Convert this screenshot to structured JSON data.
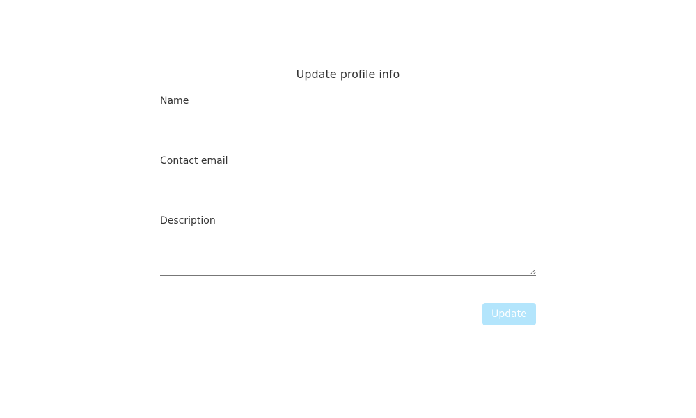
{
  "form": {
    "title": "Update profile info",
    "fields": {
      "name": {
        "label": "Name",
        "value": "",
        "placeholder": ""
      },
      "email": {
        "label": "Contact email",
        "value": "",
        "placeholder": ""
      },
      "description": {
        "label": "Description",
        "value": "",
        "placeholder": ""
      }
    },
    "submit": {
      "label": "Update",
      "state": "disabled"
    }
  },
  "colors": {
    "text": "#333333",
    "underline": "#777777",
    "button_bg": "#b3e5fc",
    "button_text": "#ffffff",
    "background": "#ffffff"
  }
}
